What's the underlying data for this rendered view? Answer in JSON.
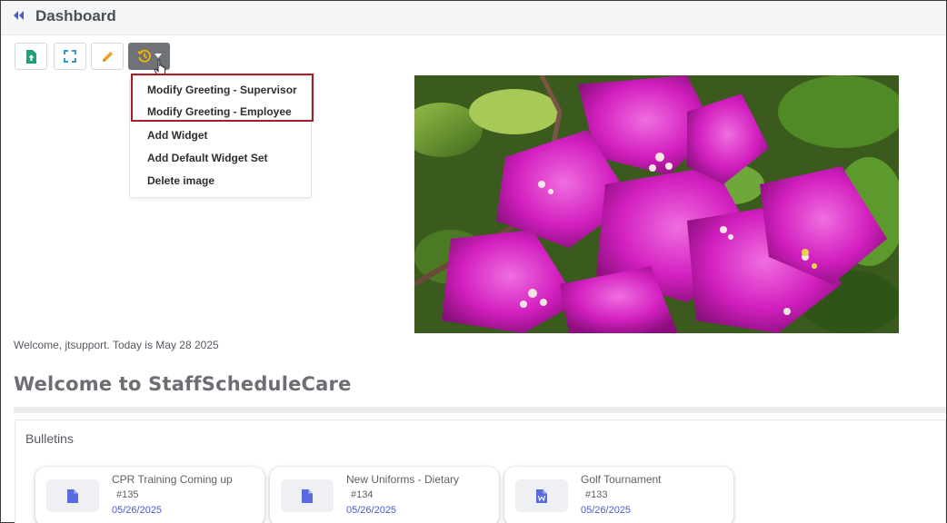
{
  "header": {
    "title": "Dashboard",
    "back_icon": "double-chevron-left-icon",
    "accent_color": "#4a5bd0"
  },
  "toolbar": {
    "buttons": [
      {
        "icon": "upload-file-icon",
        "color": "#1aa37a"
      },
      {
        "icon": "fullscreen-icon",
        "color": "#2f9bd6"
      },
      {
        "icon": "pencil-icon",
        "color": "#f0a020"
      },
      {
        "icon": "history-icon",
        "color": "#f5b400"
      }
    ]
  },
  "menu": {
    "items": [
      "Modify Greeting - Supervisor",
      "Modify Greeting - Employee",
      "Add Widget",
      "Add Default Widget Set",
      "Delete image"
    ],
    "highlight_color": "#a81c2a"
  },
  "welcome": {
    "line": "Welcome, jtsupport. Today is May 28 2025",
    "heading": "Welcome to StaffScheduleCare"
  },
  "bulletins": {
    "title": "Bulletins",
    "cards": [
      {
        "title": "CPR Training Coming up",
        "number": "#135",
        "date": "05/26/2025",
        "icon": "document-icon"
      },
      {
        "title": "New Uniforms - Dietary",
        "number": "#134",
        "date": "05/26/2025",
        "icon": "document-icon"
      },
      {
        "title": "Golf Tournament",
        "number": "#133",
        "date": "05/26/2025",
        "icon": "word-document-icon"
      }
    ]
  }
}
